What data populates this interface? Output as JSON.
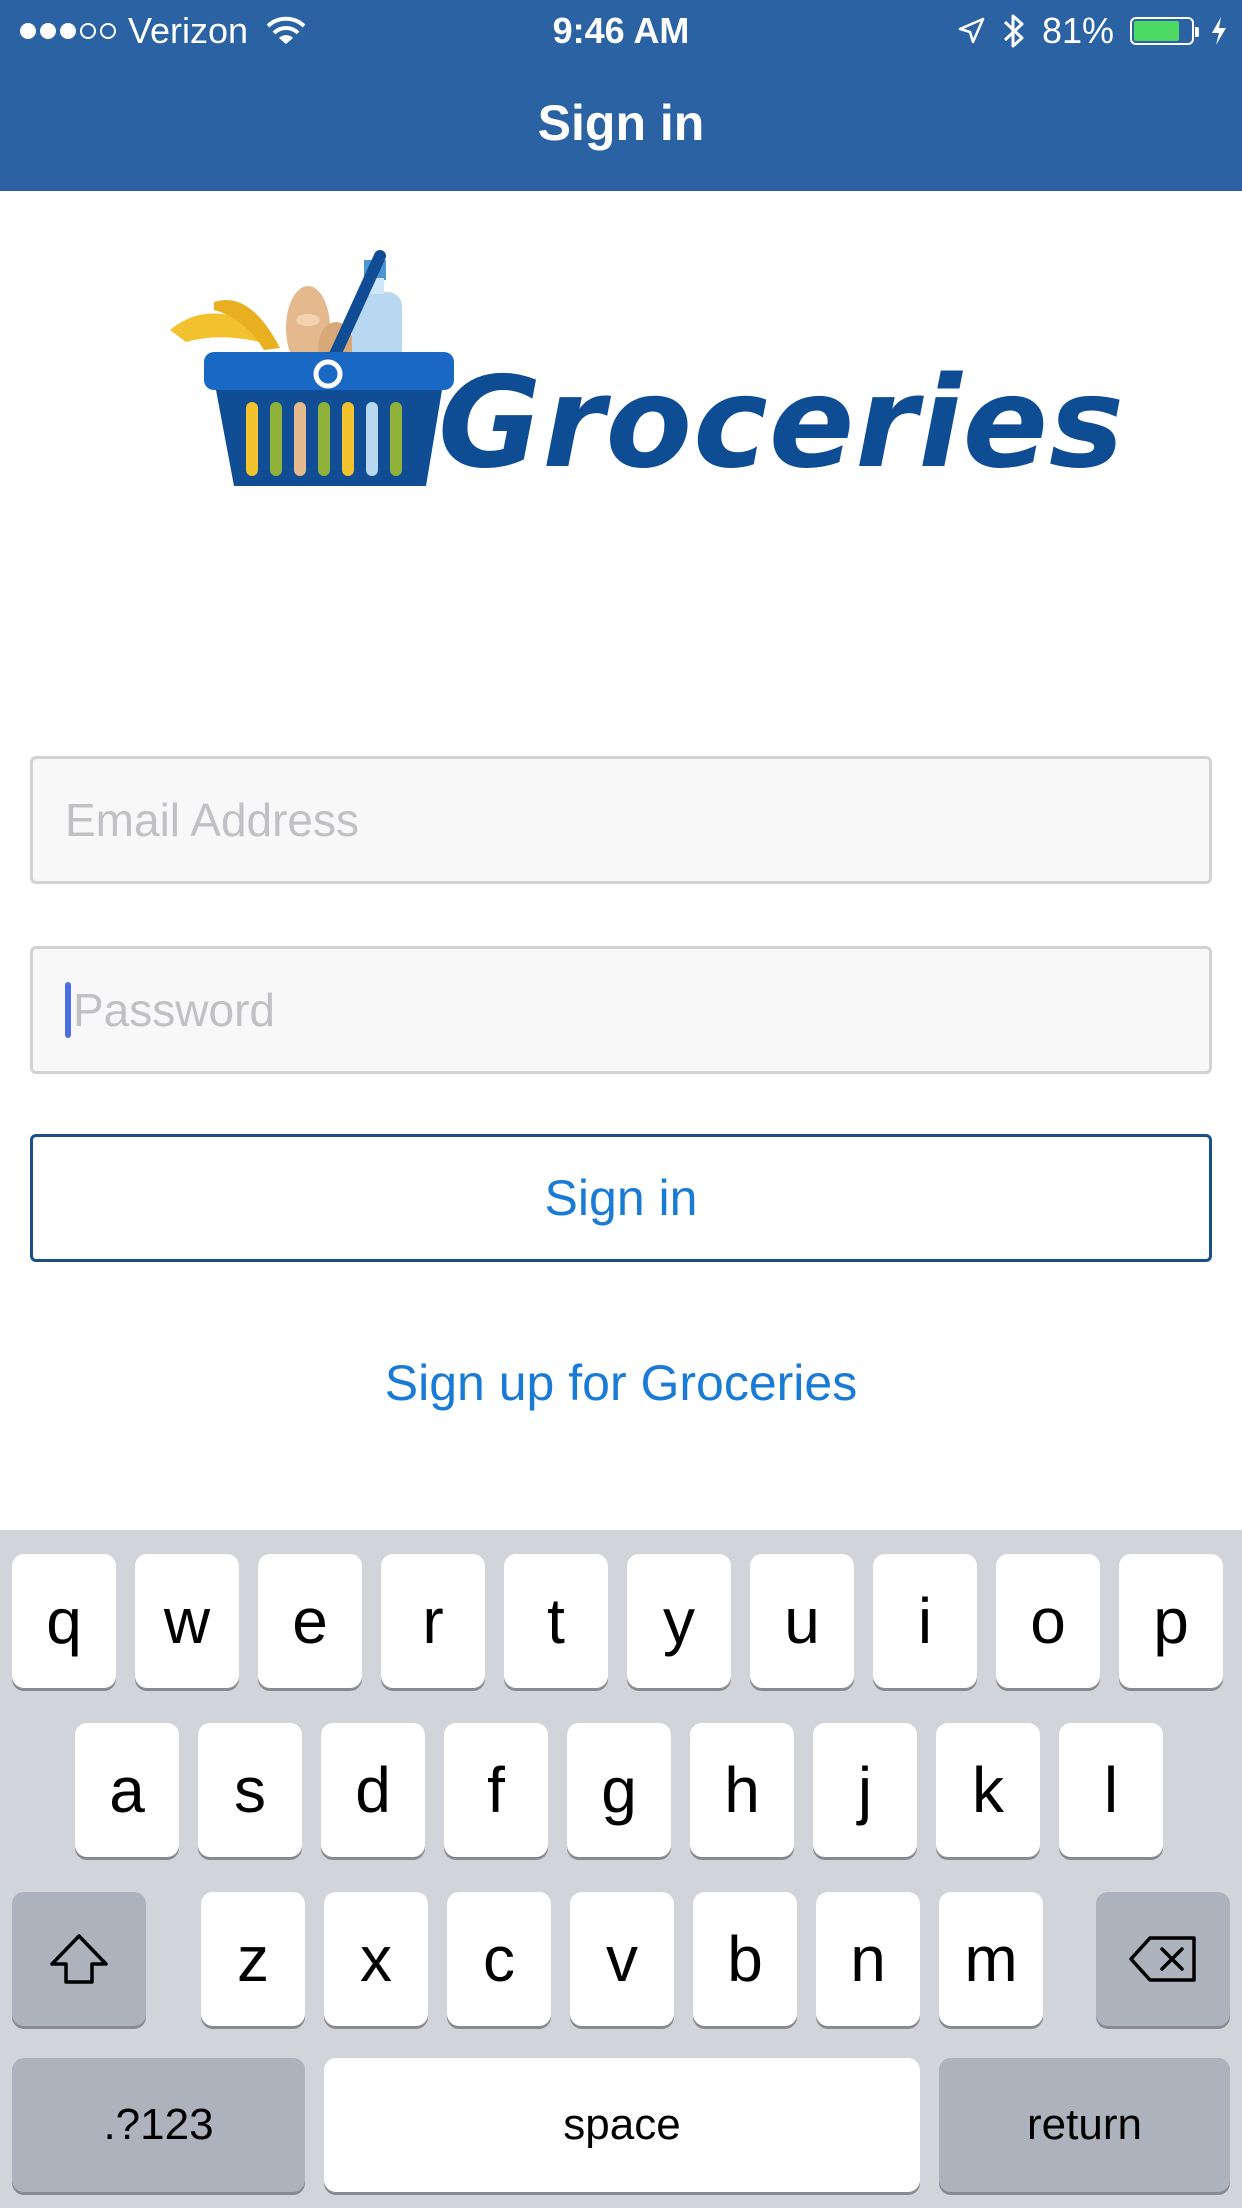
{
  "status_bar": {
    "carrier": "Verizon",
    "signal_bars_filled": 3,
    "signal_bars_total": 5,
    "time": "9:46 AM",
    "battery_percent": "81%",
    "battery_level": 0.81,
    "battery_color": "#4cd964"
  },
  "nav": {
    "title": "Sign in",
    "background": "#2a62a4"
  },
  "logo": {
    "wordmark": "Groceries",
    "color": "#0e4d94",
    "icon": "grocery-basket-icon"
  },
  "form": {
    "email_placeholder": "Email Address",
    "password_placeholder": "Password",
    "signin_label": "Sign in",
    "signup_label": "Sign up for Groceries",
    "link_color": "#1a7bd6"
  },
  "keyboard": {
    "row1": [
      "q",
      "w",
      "e",
      "r",
      "t",
      "y",
      "u",
      "i",
      "o",
      "p"
    ],
    "row2": [
      "a",
      "s",
      "d",
      "f",
      "g",
      "h",
      "j",
      "k",
      "l"
    ],
    "row3": [
      "z",
      "x",
      "c",
      "v",
      "b",
      "n",
      "m"
    ],
    "numbers_label": ".?123",
    "space_label": "space",
    "return_label": "return"
  }
}
